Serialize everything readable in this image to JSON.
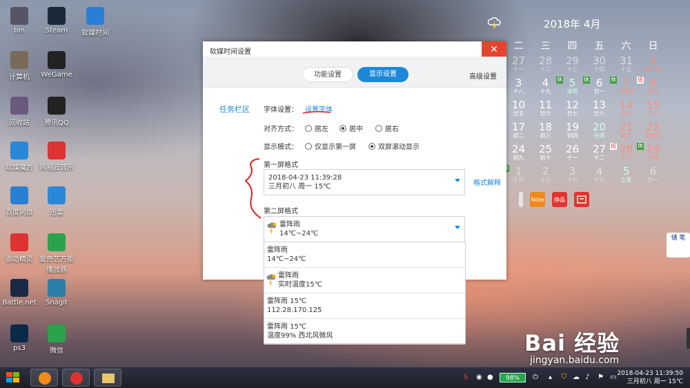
{
  "desktop": {
    "icons": [
      {
        "label": "bm",
        "color": "#556"
      },
      {
        "label": "Steam",
        "color": "#1b2838"
      },
      {
        "label": "软媒时间",
        "color": "#2a7fd4"
      },
      {
        "label": "计算机",
        "color": "#7a6a5a"
      },
      {
        "label": "WeGame",
        "color": "#222"
      },
      {
        "label": "回收站",
        "color": "#6a5a80"
      },
      {
        "label": "腾讯QQ",
        "color": "#222"
      },
      {
        "label": "软媒魔方",
        "color": "#2a88d8"
      },
      {
        "label": "网易云音乐",
        "color": "#d33"
      },
      {
        "label": "百度网盘",
        "color": "#2a7fd4"
      },
      {
        "label": "迅雷",
        "color": "#2a88d8"
      },
      {
        "label": "驱动精灵",
        "color": "#d33"
      },
      {
        "label": "爱奇艺万能播放器",
        "color": "#2aa34a"
      },
      {
        "label": "Battle.net",
        "color": "#1a2a44"
      },
      {
        "label": "Snagit",
        "color": "#2a7fa8"
      },
      {
        "label": "ps3",
        "color": "#0a2a4a"
      },
      {
        "label": "微信",
        "color": "#2aa34a"
      }
    ]
  },
  "calendar": {
    "title": "2018年 4月",
    "weekdays": [
      "二",
      "三",
      "四",
      "五",
      "六",
      "日"
    ],
    "rows": [
      [
        {
          "d": "27",
          "l": "十一",
          "dim": true
        },
        {
          "d": "28",
          "l": "十二",
          "dim": true
        },
        {
          "d": "29",
          "l": "十三",
          "dim": true
        },
        {
          "d": "30",
          "l": "十四",
          "dim": true
        },
        {
          "d": "31",
          "l": "十五",
          "dim": true
        },
        {
          "d": "1",
          "l": "愚人节",
          "red": true
        }
      ],
      [
        {
          "d": "3",
          "l": "十八"
        },
        {
          "d": "4",
          "l": "十九"
        },
        {
          "d": "5",
          "l": "清明",
          "badge": "休",
          "teal": true
        },
        {
          "d": "6",
          "l": "廿一",
          "badge": "休"
        },
        {
          "d": "7",
          "l": "卫生日",
          "badge": "休",
          "red": true
        },
        {
          "d": "8",
          "l": "廿三",
          "badge": "班",
          "work": true,
          "red": true
        }
      ],
      [
        {
          "d": "10",
          "l": "廿五"
        },
        {
          "d": "11",
          "l": "廿六"
        },
        {
          "d": "12",
          "l": "廿七"
        },
        {
          "d": "13",
          "l": "廿八"
        },
        {
          "d": "14",
          "l": "廿九",
          "red": true
        },
        {
          "d": "15",
          "l": "三十",
          "red": true
        }
      ],
      [
        {
          "d": "17",
          "l": "初二"
        },
        {
          "d": "18",
          "l": "初三"
        },
        {
          "d": "19",
          "l": "初四"
        },
        {
          "d": "20",
          "l": "谷雨",
          "teal": true
        },
        {
          "d": "21",
          "l": "初六",
          "red": true
        },
        {
          "d": "22",
          "l": "地球日",
          "red": true
        }
      ],
      [
        {
          "d": "24",
          "l": "初九"
        },
        {
          "d": "25",
          "l": "初十"
        },
        {
          "d": "26",
          "l": "十一"
        },
        {
          "d": "27",
          "l": "十二"
        },
        {
          "d": "28",
          "l": "十三",
          "badge": "班",
          "work": true,
          "red": true
        },
        {
          "d": "29",
          "l": "十四",
          "badge": "休",
          "red": true
        }
      ],
      [
        {
          "d": "1",
          "l": "十六",
          "dim": true,
          "badge": "休"
        },
        {
          "d": "2",
          "l": "十七",
          "dim": true
        },
        {
          "d": "3",
          "l": "十八",
          "dim": true
        },
        {
          "d": "4",
          "l": "十九",
          "dim": true
        },
        {
          "d": "5",
          "l": "立夏",
          "dim": true,
          "teal": true
        },
        {
          "d": "6",
          "l": "廿一",
          "dim": true
        }
      ]
    ]
  },
  "dialog": {
    "title": "软媒时间设置",
    "close": "✕",
    "tabs": {
      "function": "功能设置",
      "display": "显示设置",
      "advanced": "高级设置"
    },
    "side_nav": "任务栏区",
    "font_label": "字体设置：",
    "font_link": "设置字体",
    "align_label": "对齐方式：",
    "align_options": [
      "居左",
      "居中",
      "居右"
    ],
    "display_label": "显示模式：",
    "display_options": [
      "仅显示第一屏",
      "双屏滚动显示"
    ],
    "first_screen_label": "第一屏格式",
    "first_screen_line1": "2018-04-23 11:39:28",
    "first_screen_line2": "三月初八 周一 15℃",
    "format_help": "格式解释",
    "second_screen_label": "第二屏格式",
    "second_screen_line1": "雷阵雨",
    "second_screen_line2": "14℃~24℃"
  },
  "dropdown": [
    {
      "line1": "雷阵雨",
      "line2": "14℃~24℃",
      "icon": false
    },
    {
      "line1": "雷阵雨",
      "line2": "实时温度15℃",
      "icon": true
    },
    {
      "line1": "雷阵雨 15℃",
      "line2": "112.28.170.125",
      "icon": false
    },
    {
      "line1": "雷阵雨 15℃",
      "line2": "温度99% 西北风微风",
      "icon": false
    }
  ],
  "tiles": [
    "",
    "Note",
    "挣品",
    ""
  ],
  "side_widget": "储 笔",
  "watermark": {
    "brand": "Bai 经验",
    "url": "jingyan.baidu.com"
  },
  "taskbar": {
    "battery": "98%",
    "time": "2018-04-23 11:39:50",
    "date": "三月初八 周一 15℃"
  },
  "colors": {
    "accent": "#1e88d8",
    "close": "#e4452e",
    "annotation": "#e02020"
  }
}
